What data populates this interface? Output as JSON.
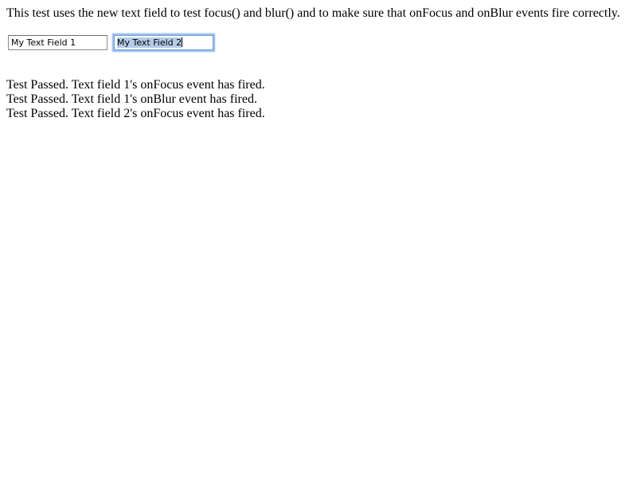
{
  "intro_text": "This test uses the new text field to test focus() and blur() and to make sure that onFocus and onBlur events fire correctly.",
  "fields": [
    {
      "value": "My Text Field 1",
      "focused": false
    },
    {
      "value": "My Text Field 2",
      "focused": true,
      "selected": true
    }
  ],
  "results": [
    "Test Passed. Text field 1's onFocus event has fired.",
    "Test Passed. Text field 1's onBlur event has fired.",
    "Test Passed. Text field 2's onFocus event has fired."
  ],
  "colors": {
    "focus_ring": "#9ec2ee",
    "selection": "#b5cbe8"
  }
}
